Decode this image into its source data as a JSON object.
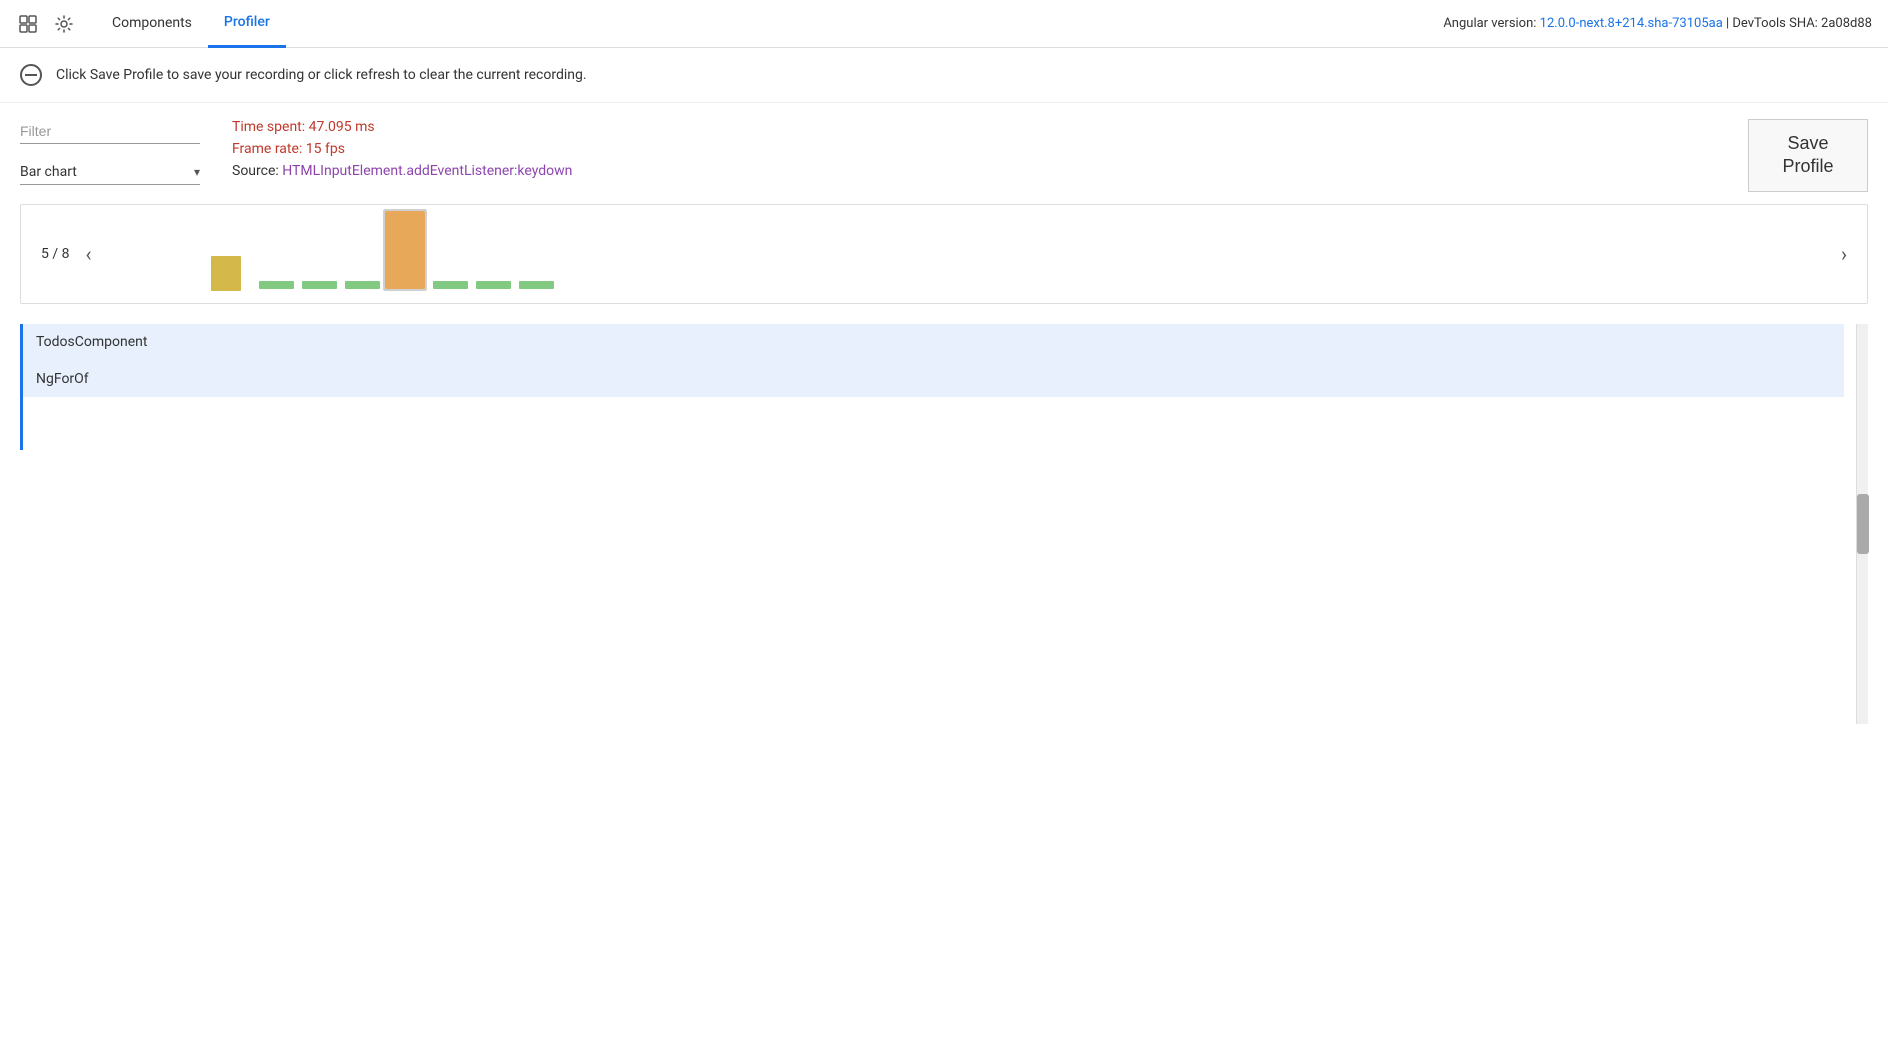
{
  "header": {
    "icon_label": "devtools-icon",
    "gear_label": "settings-icon",
    "tabs": [
      {
        "id": "components",
        "label": "Components",
        "active": false
      },
      {
        "id": "profiler",
        "label": "Profiler",
        "active": true
      }
    ],
    "version_text": "Angular version: ",
    "version_link": "12.0.0-next.8+214.sha-73105aa",
    "devtools_sha": " | DevTools SHA: 2a08d88"
  },
  "info_bar": {
    "message": "Click Save Profile to save your recording or click refresh to clear the current recording."
  },
  "controls": {
    "filter_placeholder": "Filter",
    "chart_type": "Bar chart",
    "chart_type_arrow": "▾",
    "time_spent_label": "Time spent: ",
    "time_spent_value": "47.095 ms",
    "frame_rate_label": "Frame rate: ",
    "frame_rate_value": "15 fps",
    "source_label": "Source: ",
    "source_value": "HTMLInputElement.addEventListener:keydown",
    "save_button": "Save\nProfile"
  },
  "chart": {
    "current_page": "5",
    "total_pages": "8",
    "page_display": "5 / 8",
    "prev_arrow": "‹",
    "next_arrow": "›"
  },
  "components": [
    {
      "name": "TodosComponent"
    },
    {
      "name": "NgForOf"
    }
  ],
  "bar_chart_data": {
    "bars": [
      {
        "type": "yellow",
        "height": 35,
        "selected": false
      },
      {
        "type": "green-dash",
        "height": 8,
        "selected": false
      },
      {
        "type": "green-dash",
        "height": 8,
        "selected": false
      },
      {
        "type": "green-dash",
        "height": 8,
        "selected": false
      },
      {
        "type": "orange",
        "height": 75,
        "selected": true
      },
      {
        "type": "green-dash",
        "height": 8,
        "selected": false
      },
      {
        "type": "green-dash",
        "height": 8,
        "selected": false
      },
      {
        "type": "green-dash",
        "height": 8,
        "selected": false
      }
    ]
  }
}
